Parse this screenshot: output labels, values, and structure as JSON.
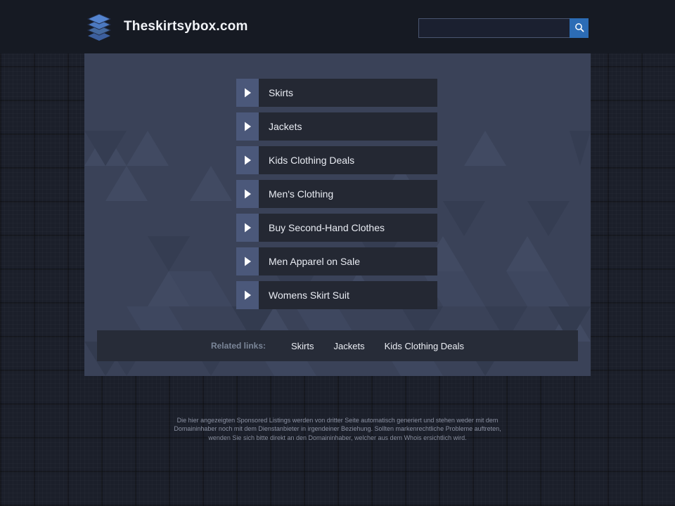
{
  "header": {
    "logo_icon": "layers-stack-icon",
    "site_title": "Theskirtsybox.com",
    "search": {
      "value": "",
      "placeholder": "",
      "button_icon": "search-icon",
      "button_color": "#2c6cb5"
    }
  },
  "main": {
    "menu": [
      {
        "label": "Skirts",
        "arrow_icon": "play-triangle-icon"
      },
      {
        "label": "Jackets",
        "arrow_icon": "play-triangle-icon"
      },
      {
        "label": "Kids Clothing Deals",
        "arrow_icon": "play-triangle-icon"
      },
      {
        "label": "Men's Clothing",
        "arrow_icon": "play-triangle-icon"
      },
      {
        "label": "Buy Second-Hand Clothes",
        "arrow_icon": "play-triangle-icon"
      },
      {
        "label": "Men Apparel on Sale",
        "arrow_icon": "play-triangle-icon"
      },
      {
        "label": "Womens Skirt Suit",
        "arrow_icon": "play-triangle-icon"
      }
    ],
    "related": {
      "label": "Related links:",
      "links": [
        "Skirts",
        "Jackets",
        "Kids Clothing Deals"
      ]
    }
  },
  "footer": {
    "disclaimer": "Die hier angezeigten Sponsored Listings werden von dritter Seite automatisch generiert und stehen weder mit dem Domaininhaber noch mit dem Dienstanbieter in irgendeiner Beziehung. Sollten markenrechtliche Probleme auftreten, wenden Sie sich bitte direkt an den Domaininhaber, welcher aus dem Whois ersichtlich wird."
  },
  "colors": {
    "page_background": "#1b1f2a",
    "header_background": "#161a23",
    "panel_background": "#3a4258",
    "menu_item_background": "#242833",
    "menu_arrow_background": "#4b587a",
    "accent_blue": "#2c6cb5",
    "logo_blue": "#4a72c4"
  }
}
